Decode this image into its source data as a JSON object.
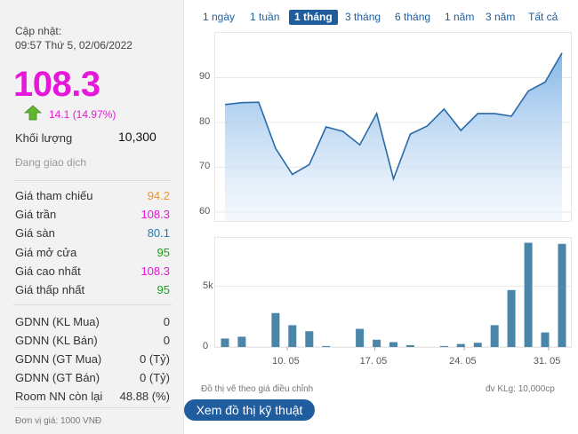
{
  "summary": {
    "update_label": "Cập nhật:",
    "update_time": "09:57 Thứ 5, 02/06/2022",
    "price": "108.3",
    "change": "14.1 (14.97%)",
    "volume_label": "Khối lượng",
    "volume_value": "10,300",
    "status": "Đang giao dịch"
  },
  "price_stats": [
    {
      "label": "Giá tham chiếu",
      "value": "94.2",
      "color": "#f0961e"
    },
    {
      "label": "Giá trần",
      "value": "108.3",
      "color": "#e617d8"
    },
    {
      "label": "Giá sàn",
      "value": "80.1",
      "color": "#1e7fb8"
    },
    {
      "label": "Giá mở cửa",
      "value": "95",
      "color": "#1aa01a"
    },
    {
      "label": "Giá cao nhất",
      "value": "108.3",
      "color": "#e617d8"
    },
    {
      "label": "Giá thấp nhất",
      "value": "95",
      "color": "#1aa01a"
    }
  ],
  "foreign_stats": [
    {
      "label": "GDNN (KL Mua)",
      "value": "0"
    },
    {
      "label": "GDNN (KL Bán)",
      "value": "0"
    },
    {
      "label": "GDNN (GT Mua)",
      "value": "0 (Tỷ)"
    },
    {
      "label": "GDNN (GT Bán)",
      "value": "0 (Tỷ)"
    },
    {
      "label": "Room NN còn lại",
      "value": "48.88 (%)"
    }
  ],
  "price_unit_note": "Đơn vị giá: 1000 VNĐ",
  "tabs": [
    "1 ngày",
    "1 tuần",
    "1 tháng",
    "3 tháng",
    "6 tháng",
    "1 năm",
    "3 năm",
    "Tất cả"
  ],
  "active_tab": "1 tháng",
  "chart_footer_left": "Đồ thị vẽ theo giá điều chỉnh",
  "chart_footer_right": "đv KLg: 10,000cp",
  "tech_button": "Xem đồ thị kỹ thuật",
  "chart_data": [
    {
      "type": "area",
      "name": "price",
      "y_ticks": [
        "60",
        "70",
        "80",
        "90"
      ],
      "ylim": [
        58,
        100
      ],
      "values": [
        84.0,
        84.4,
        84.5,
        74.2,
        68.4,
        70.6,
        79.0,
        78.0,
        75.0,
        82.0,
        67.4,
        77.4,
        79.2,
        83.0,
        78.2,
        82.0,
        82.0,
        81.4,
        87.0,
        89.0,
        95.5
      ],
      "grid": true
    },
    {
      "type": "bar",
      "name": "volume",
      "y_ticks": [
        "0",
        "5k"
      ],
      "ylim": [
        0,
        9000
      ],
      "x_tick_labels": [
        "10. 05",
        "17. 05",
        "24. 05",
        "31. 05"
      ],
      "x_tick_index": [
        3.7,
        8.9,
        14.2,
        19.2
      ],
      "values": [
        700,
        850,
        0,
        2800,
        1800,
        1300,
        80,
        0,
        1500,
        600,
        400,
        150,
        0,
        80,
        250,
        350,
        1800,
        4700,
        8600,
        1200,
        8500
      ],
      "grid": true
    }
  ]
}
